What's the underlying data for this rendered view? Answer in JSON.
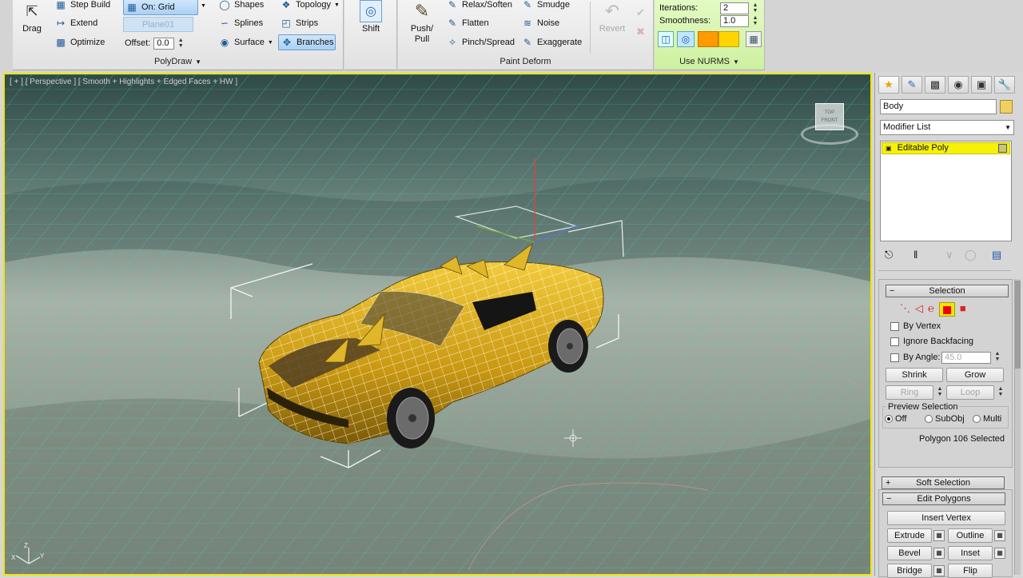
{
  "ribbon": {
    "polydraw": {
      "drag_label": "Drag",
      "step_build_label": "Step Build",
      "extend_label": "Extend",
      "optimize_label": "Optimize",
      "on_grid_label": "On: Grid",
      "plane_field_label": "Plane01",
      "offset_label": "Offset:",
      "offset_value": "0.0",
      "shapes_label": "Shapes",
      "splines_label": "Splines",
      "surface_label": "Surface",
      "topology_label": "Topology",
      "strips_label": "Strips",
      "branches_label": "Branches",
      "panel_title": "PolyDraw"
    },
    "shift_label": "Shift",
    "paint_deform": {
      "push_pull_label": "Push/\nPull",
      "relax_soften_label": "Relax/Soften",
      "flatten_label": "Flatten",
      "pinch_spread_label": "Pinch/Spread",
      "smudge_label": "Smudge",
      "noise_label": "Noise",
      "exaggerate_label": "Exaggerate",
      "revert_label": "Revert",
      "panel_title": "Paint Deform"
    },
    "nurms": {
      "iterations_label": "Iterations:",
      "iterations_value": "2",
      "smoothness_label": "Smoothness:",
      "smoothness_value": "1.0",
      "panel_title": "Use NURMS"
    }
  },
  "viewport": {
    "label": "[ + ] [ Perspective ] [ Smooth + Highlights + Edged Faces + HW ]",
    "viewcube_top_label": "TOP",
    "viewcube_front_label": "FRONT",
    "axis_x": "X",
    "axis_y": "Y",
    "axis_z": "Z"
  },
  "command_panel": {
    "object_name": "Body",
    "modifier_list_label": "Modifier List",
    "stack_item": "Editable Poly",
    "selection": {
      "title": "Selection",
      "by_vertex": "By Vertex",
      "ignore_backfacing": "Ignore Backfacing",
      "by_angle": "By Angle:",
      "by_angle_value": "45.0",
      "shrink": "Shrink",
      "grow": "Grow",
      "ring": "Ring",
      "loop": "Loop",
      "preview_title": "Preview Selection",
      "preview_off": "Off",
      "preview_subobj": "SubObj",
      "preview_multi": "Multi",
      "status": "Polygon 106 Selected"
    },
    "soft_selection_title": "Soft Selection",
    "edit_polygons": {
      "title": "Edit Polygons",
      "insert_vertex": "Insert Vertex",
      "extrude": "Extrude",
      "outline": "Outline",
      "bevel": "Bevel",
      "inset": "Inset",
      "bridge": "Bridge",
      "flip": "Flip"
    }
  },
  "colors": {
    "viewport_active_border": "#f2e600",
    "nurms_panel_bg": "#d9f7b5",
    "stack_highlight": "#f7f10a",
    "car_body": "#d7a515",
    "grid_lines": "#3fd6c8"
  }
}
